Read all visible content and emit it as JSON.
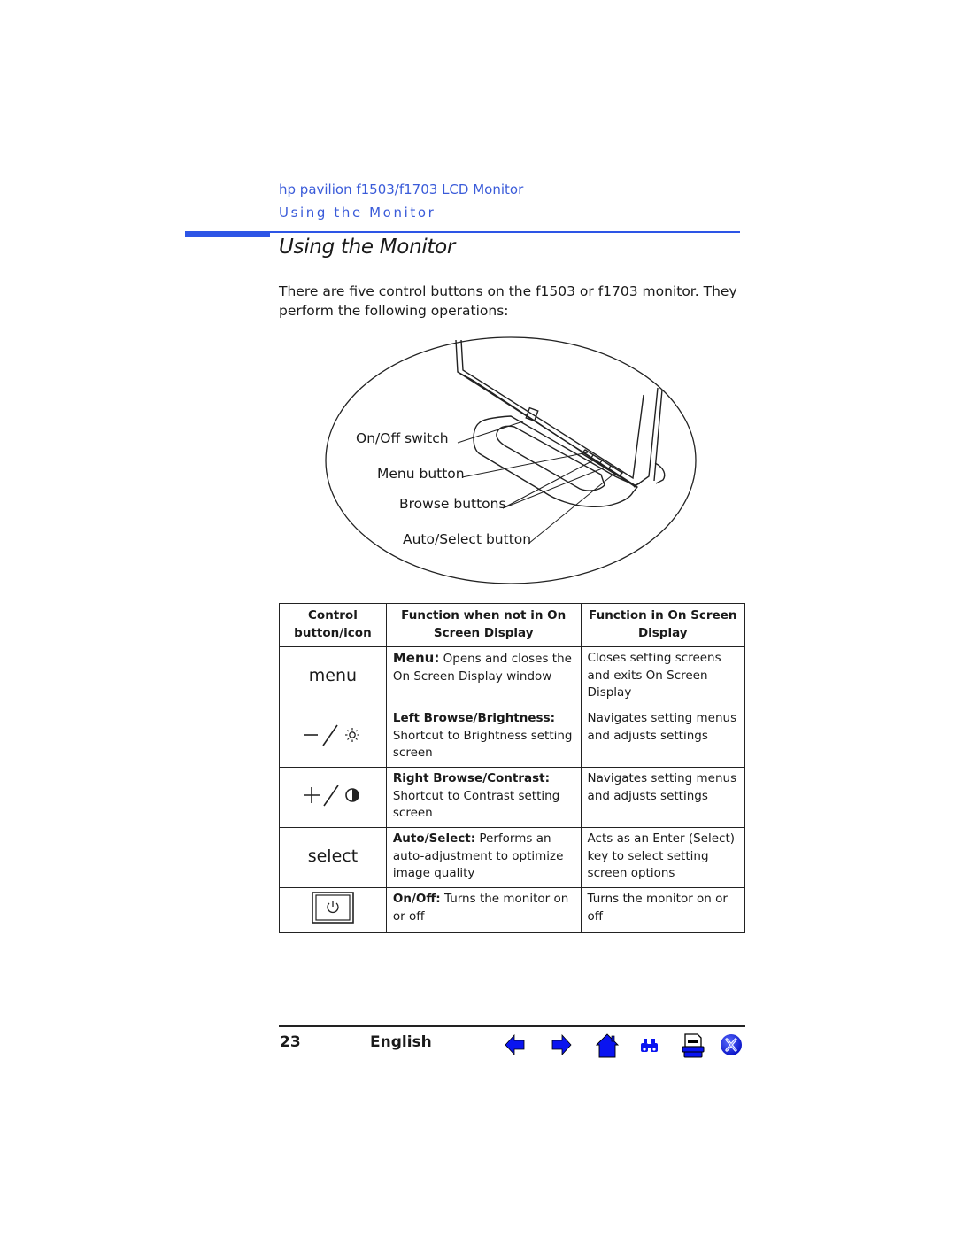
{
  "header": {
    "product": "hp pavilion f1503/f1703 LCD Monitor",
    "section": "Using the Monitor"
  },
  "page_title": "Using the Monitor",
  "intro": "There are five control buttons on the f1503 or f1703 monitor. They perform the following operations:",
  "diagram": {
    "labels": {
      "on_off": "On/Off switch",
      "menu": "Menu button",
      "browse": "Browse buttons",
      "auto_select": "Auto/Select button"
    }
  },
  "table": {
    "headers": [
      "Control button/icon",
      "Function when not in On Screen Display",
      "Function in On Screen Display"
    ],
    "rows": [
      {
        "control_text": "menu",
        "control_icon": "",
        "name": "Menu:",
        "desc": " Opens and closes the On Screen Display window",
        "osd": "Closes setting screens and exits On Screen Display"
      },
      {
        "control_text": "",
        "control_icon": "minus-slash-brightness-icon",
        "name": "Left Browse/Brightness:",
        "desc": "Shortcut to Brightness setting screen",
        "osd": "Navigates setting menus and adjusts settings"
      },
      {
        "control_text": "",
        "control_icon": "plus-slash-contrast-icon",
        "name": "Right Browse/Contrast:",
        "desc": "Shortcut to Contrast setting screen",
        "osd": "Navigates setting menus and adjusts settings"
      },
      {
        "control_text": "select",
        "control_icon": "",
        "name": "Auto/Select:",
        "desc": " Performs an auto-adjustment to optimize image quality",
        "osd": "Acts as an Enter (Select) key to select setting screen options"
      },
      {
        "control_text": "",
        "control_icon": "power-button-icon",
        "name": "On/Off:",
        "desc": " Turns the monitor on or off",
        "osd": "Turns the monitor on or off"
      }
    ]
  },
  "footer": {
    "page_number": "23",
    "language": "English",
    "nav_icons": [
      "previous-page-icon",
      "next-page-icon",
      "home-icon",
      "search-binoculars-icon",
      "print-icon",
      "exit-icon"
    ]
  },
  "colors": {
    "accent_blue": "#2d55e6",
    "header_text_blue": "#3a5bd9",
    "nav_icon_blue": "#0a14f0"
  }
}
